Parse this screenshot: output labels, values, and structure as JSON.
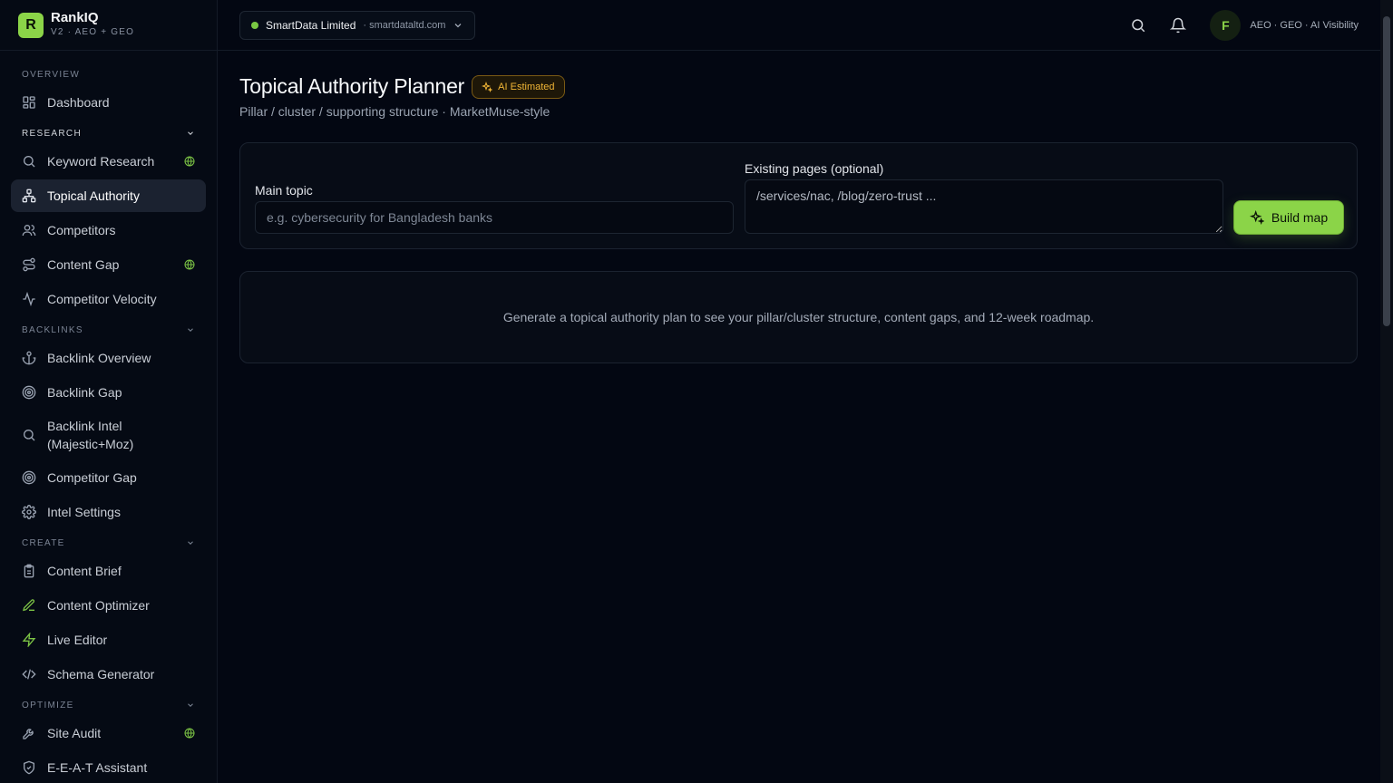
{
  "brand": {
    "logo_letter": "R",
    "name": "RankIQ",
    "subtitle": "V2 · AEO + GEO"
  },
  "sidebar": {
    "sections": [
      {
        "label": "OVERVIEW",
        "items": [
          {
            "label": "Dashboard",
            "icon": "dashboard-icon"
          }
        ]
      },
      {
        "label": "RESEARCH",
        "items": [
          {
            "label": "Keyword Research",
            "icon": "search-icon",
            "globe": true
          },
          {
            "label": "Topical Authority",
            "icon": "sitemap-icon",
            "active": true
          },
          {
            "label": "Competitors",
            "icon": "users-icon"
          },
          {
            "label": "Content Gap",
            "icon": "route-icon",
            "globe": true
          },
          {
            "label": "Competitor Velocity",
            "icon": "activity-icon"
          }
        ]
      },
      {
        "label": "BACKLINKS",
        "items": [
          {
            "label": "Backlink Overview",
            "icon": "anchor-icon"
          },
          {
            "label": "Backlink Gap",
            "icon": "target-icon"
          },
          {
            "label": "Backlink Intel (Majestic+Moz)",
            "icon": "search-icon"
          },
          {
            "label": "Competitor Gap",
            "icon": "target-icon"
          },
          {
            "label": "Intel Settings",
            "icon": "gear-icon"
          }
        ]
      },
      {
        "label": "CREATE",
        "items": [
          {
            "label": "Content Brief",
            "icon": "clipboard-icon"
          },
          {
            "label": "Content Optimizer",
            "icon": "pencil-icon"
          },
          {
            "label": "Live Editor",
            "icon": "lightning-icon"
          },
          {
            "label": "Schema Generator",
            "icon": "code-icon"
          }
        ]
      },
      {
        "label": "OPTIMIZE",
        "items": [
          {
            "label": "Site Audit",
            "icon": "wrench-icon",
            "globe": true
          },
          {
            "label": "E-E-A-T Assistant",
            "icon": "shield-check-icon"
          }
        ]
      }
    ]
  },
  "topbar": {
    "project_name": "SmartData Limited",
    "project_domain": "· smartdataltd.com",
    "status_color": "#79c843",
    "avatar_letter": "F",
    "user_tag": "AEO · GEO · AI Visibility"
  },
  "page": {
    "title": "Topical Authority Planner",
    "badge": "AI Estimated",
    "subtitle": "Pillar / cluster / supporting structure · MarketMuse-style"
  },
  "form": {
    "main_topic_label": "Main topic",
    "main_topic_value": "",
    "main_topic_placeholder": "e.g. cybersecurity for Bangladesh banks",
    "existing_pages_label": "Existing pages (optional)",
    "existing_pages_value": "",
    "existing_pages_placeholder": "/services/nac, /blog/zero-trust ...",
    "build_button": "Build map"
  },
  "empty_state": "Generate a topical authority plan to see your pillar/cluster structure, content gaps, and 12-week roadmap.",
  "colors": {
    "accent": "#8bd448",
    "badge": "#f1b636",
    "background": "#030712"
  }
}
